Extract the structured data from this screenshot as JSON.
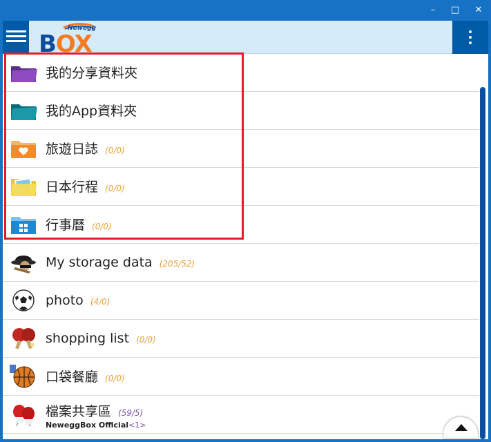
{
  "window": {
    "minimize_glyph": "–",
    "maximize_glyph": "□",
    "close_glyph": "✕"
  },
  "header": {
    "logo_text_b": "B",
    "logo_text_o": "O",
    "logo_text_x": "X",
    "logo_brand": "Newegg",
    "menu_icon": "hamburger-icon",
    "more_icon": "vertical-dots-icon"
  },
  "items": [
    {
      "label": "我的分享資料夾",
      "count": "",
      "icon": "purple-folder-icon"
    },
    {
      "label": "我的App資料夾",
      "count": "",
      "icon": "teal-folder-icon"
    },
    {
      "label": "旅遊日誌",
      "count": "(0/0)",
      "icon": "orange-heart-folder-icon"
    },
    {
      "label": "日本行程",
      "count": "(0/0)",
      "icon": "yellow-photo-folder-icon"
    },
    {
      "label": "行事曆",
      "count": "(0/0)",
      "icon": "blue-grid-folder-icon"
    },
    {
      "label": "My storage data",
      "count": "(205/52)",
      "icon": "spy-hat-icon"
    },
    {
      "label": "photo",
      "count": "(4/0)",
      "icon": "soccer-ball-icon"
    },
    {
      "label": "shopping list",
      "count": "(0/0)",
      "icon": "ping-pong-icon"
    },
    {
      "label": "口袋餐廳",
      "count": "(0/0)",
      "icon": "basketball-icon"
    },
    {
      "label": "檔案共享區",
      "count": "(59/5)",
      "icon": "boxing-gloves-icon",
      "owner": "NeweggBox Official",
      "owner_count": "<1>"
    }
  ],
  "colors": {
    "titlebar": "#1672c4",
    "header_bg": "#d6ebfa",
    "header_buttons": "#005ba6",
    "highlight_border": "#e11d2a",
    "count_text": "#e8a13a"
  }
}
